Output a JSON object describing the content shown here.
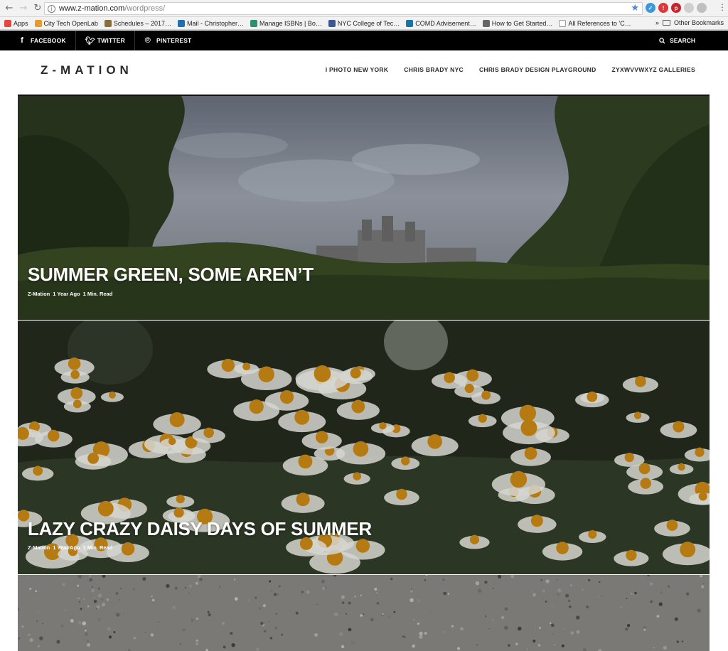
{
  "browser": {
    "url_host": "www.z-mation.com",
    "url_path": "/wordpress/",
    "bookmarks": [
      {
        "label": "Apps",
        "color": "#e8453c"
      },
      {
        "label": "City Tech OpenLab",
        "color": "#e89b2c"
      },
      {
        "label": "Schedules – 2017…",
        "color": "#8a6d3b"
      },
      {
        "label": "Mail - Christopher…",
        "color": "#1f6fb5"
      },
      {
        "label": "Manage ISBNs | Bo…",
        "color": "#2f8f6f"
      },
      {
        "label": "NYC College of Tec…",
        "color": "#3b5998"
      },
      {
        "label": "COMD Advisement…",
        "color": "#1a73a8"
      },
      {
        "label": "How to Get Started…",
        "color": "#666666"
      },
      {
        "label": "All References to 'C…",
        "color": "#999999"
      }
    ],
    "bookmarks_overflow": "»",
    "other_bookmarks": "Other Bookmarks"
  },
  "social": {
    "items": [
      "FACEBOOK",
      "TWITTER",
      "PINTEREST"
    ],
    "search": "SEARCH"
  },
  "header": {
    "logo": "Z-MATION",
    "nav": [
      "I PHOTO NEW YORK",
      "CHRIS BRADY NYC",
      "CHRIS BRADY DESIGN PLAYGROUND",
      "ZYXWVVWXYZ GALLERIES"
    ]
  },
  "posts": [
    {
      "title": "SUMMER GREEN, SOME AREN’T",
      "author": "Z-Mation",
      "date": "1 Year Ago",
      "read": "1 Min. Read"
    },
    {
      "title": "LAZY CRAZY DAISY DAYS OF SUMMER",
      "author": "Z-Mation",
      "date": "1 Year Ago",
      "read": "1 Min. Read"
    }
  ]
}
